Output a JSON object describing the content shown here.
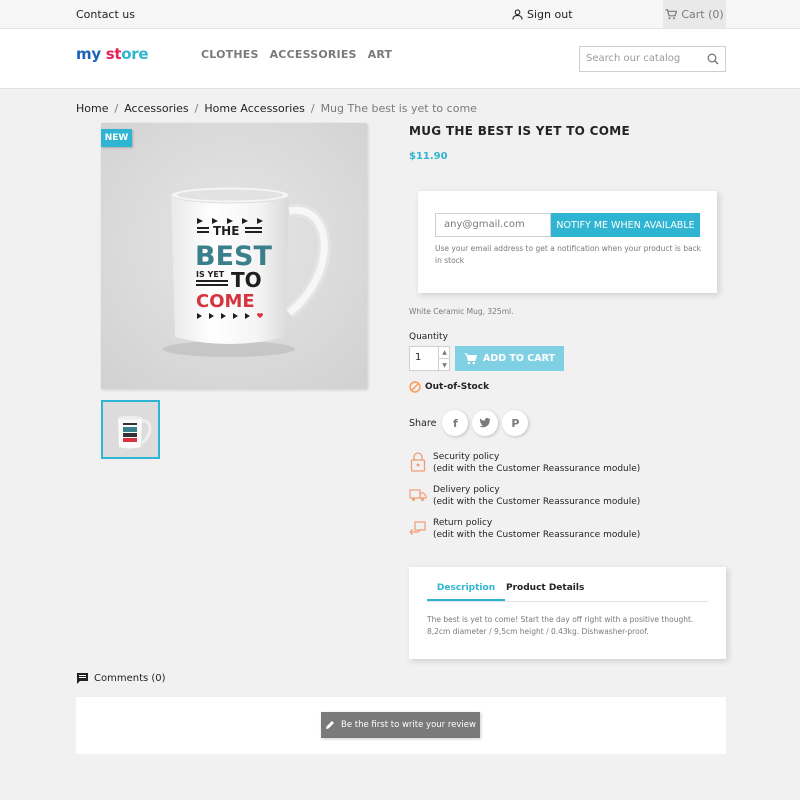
{
  "topbar": {
    "contact": "Contact us",
    "signout": "Sign out",
    "cart": "Cart (0)"
  },
  "header": {
    "logo": {
      "part1": "my ",
      "part2": "st",
      "part3": "ore"
    },
    "nav": [
      "CLOTHES",
      "ACCESSORIES",
      "ART"
    ],
    "search_placeholder": "Search our catalog"
  },
  "breadcrumb": [
    "Home",
    "Accessories",
    "Home Accessories",
    "Mug The best is yet to come"
  ],
  "product": {
    "badge": "NEW",
    "title": "MUG THE BEST IS YET TO COME",
    "price": "$11.90",
    "mug_text": {
      "the": "THE",
      "best": "BEST",
      "isyet": "IS YET",
      "to": "TO",
      "come": "COME"
    },
    "notify": {
      "placeholder": "any@gmail.com",
      "button": "NOTIFY ME WHEN AVAILABLE",
      "help": "Use your email address to get a notification when your product is back in stock"
    },
    "short_description": "White Ceramic Mug, 325ml.",
    "quantity_label": "Quantity",
    "quantity_value": "1",
    "add_to_cart": "ADD TO CART",
    "stock_status": "Out-of-Stock",
    "share_label": "Share",
    "share_buttons": [
      "facebook-share",
      "twitter-share",
      "pinterest-share"
    ]
  },
  "reassurance": [
    {
      "title": "Security policy",
      "sub": "(edit with the Customer Reassurance module)",
      "icon": "lock-icon"
    },
    {
      "title": "Delivery policy",
      "sub": "(edit with the Customer Reassurance module)",
      "icon": "truck-icon"
    },
    {
      "title": "Return policy",
      "sub": "(edit with the Customer Reassurance module)",
      "icon": "return-icon"
    }
  ],
  "tabs": {
    "items": [
      "Description",
      "Product Details"
    ],
    "active": "Description",
    "description": "The best is yet to come! Start the day off right with a positive thought. 8,2cm diameter / 9,5cm height / 0.43kg. Dishwasher-proof."
  },
  "comments": {
    "label": "Comments (0)",
    "review_button": "Be the first to write your review"
  },
  "colors": {
    "accent": "#2fb5d2",
    "logo_blue": "#1c62b9",
    "logo_pink": "#e5245b",
    "stock_orange": "#ff9a52",
    "mug_teal": "#3a7f8c",
    "mug_red": "#d8343f"
  }
}
